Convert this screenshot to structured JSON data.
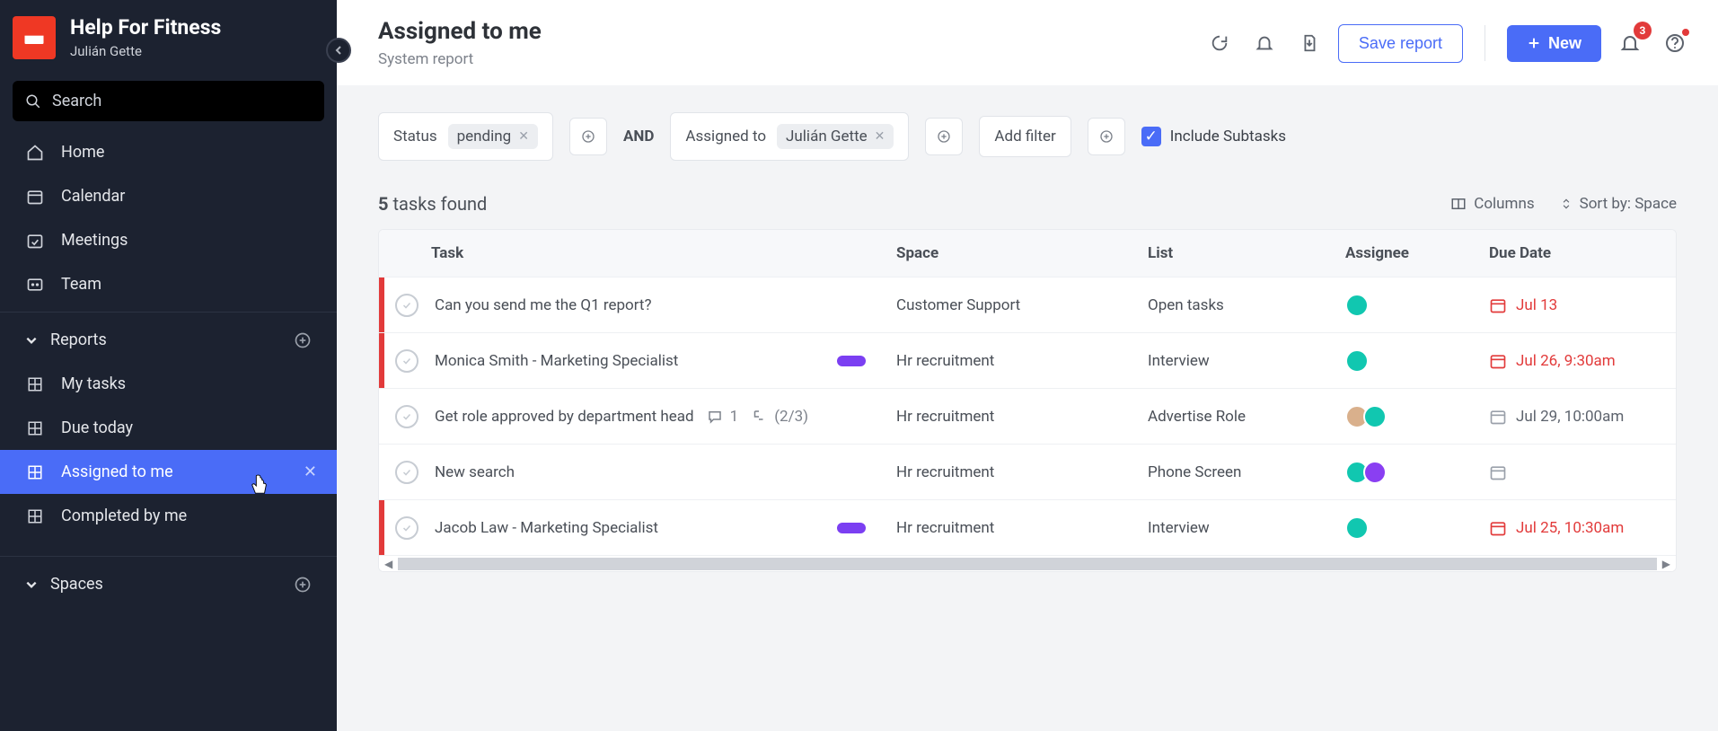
{
  "workspace": {
    "name": "Help For Fitness",
    "user": "Julián Gette"
  },
  "sidebar": {
    "search_placeholder": "Search",
    "nav": [
      {
        "label": "Home"
      },
      {
        "label": "Calendar"
      },
      {
        "label": "Meetings"
      },
      {
        "label": "Team"
      }
    ],
    "sections": {
      "reports": {
        "label": "Reports",
        "items": [
          {
            "label": "My tasks"
          },
          {
            "label": "Due today"
          },
          {
            "label": "Assigned to me",
            "active": true
          },
          {
            "label": "Completed by me"
          }
        ]
      },
      "spaces": {
        "label": "Spaces"
      }
    }
  },
  "header": {
    "title": "Assigned to me",
    "subtitle": "System report",
    "save_label": "Save report",
    "new_label": "New",
    "notif_count": "3"
  },
  "filters": {
    "status_label": "Status",
    "status_value": "pending",
    "and_label": "AND",
    "assigned_label": "Assigned to",
    "assigned_value": "Julián Gette",
    "add_filter_label": "Add filter",
    "include_subtasks_label": "Include Subtasks"
  },
  "results": {
    "count": "5",
    "count_label": "tasks found",
    "columns_label": "Columns",
    "sort_label": "Sort by: Space"
  },
  "table": {
    "headers": {
      "task": "Task",
      "space": "Space",
      "list": "List",
      "assignee": "Assignee",
      "due": "Due Date"
    },
    "rows": [
      {
        "priority": "red",
        "name": "Can you send me the Q1 report?",
        "space": "Customer Support",
        "list": "Open tasks",
        "assignees": [
          "teal"
        ],
        "due": "Jul 13",
        "due_status": "overdue"
      },
      {
        "priority": "red",
        "name": "Monica Smith - Marketing Specialist",
        "pill": true,
        "space": "Hr recruitment",
        "list": "Interview",
        "assignees": [
          "teal"
        ],
        "due": "Jul 26, 9:30am",
        "due_status": "overdue"
      },
      {
        "priority": "",
        "name": "Get role approved by department head",
        "comments": "1",
        "subtasks": "(2/3)",
        "space": "Hr recruitment",
        "list": "Advertise Role",
        "assignees": [
          "img",
          "teal"
        ],
        "due": "Jul 29, 10:00am",
        "due_status": "normal"
      },
      {
        "priority": "",
        "name": "New search",
        "space": "Hr recruitment",
        "list": "Phone Screen",
        "assignees": [
          "teal",
          "purple"
        ],
        "due": "",
        "due_status": "none"
      },
      {
        "priority": "red",
        "name": "Jacob Law - Marketing Specialist",
        "pill": true,
        "space": "Hr recruitment",
        "list": "Interview",
        "assignees": [
          "teal"
        ],
        "due": "Jul 25, 10:30am",
        "due_status": "overdue"
      }
    ]
  }
}
